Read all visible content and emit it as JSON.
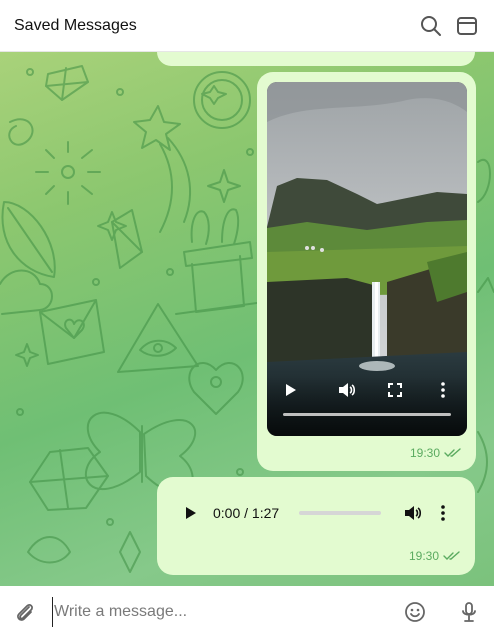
{
  "header": {
    "title": "Saved Messages",
    "icons": [
      "search-icon",
      "sidebar-panel-icon"
    ]
  },
  "messages": {
    "video": {
      "time": "19:30",
      "status_icon": "double-check-icon",
      "progress": 0
    },
    "audio": {
      "time_display": "0:00 / 1:27",
      "progress": 0,
      "time": "19:30",
      "status_icon": "double-check-icon"
    }
  },
  "composer": {
    "placeholder": "Write a message...",
    "icons": [
      "paperclip-icon",
      "emoji-icon",
      "microphone-icon"
    ]
  },
  "colors": {
    "bubble": "#e3fbd0",
    "timestamp": "#5bab60",
    "chat_bg": "#7bc27c"
  }
}
